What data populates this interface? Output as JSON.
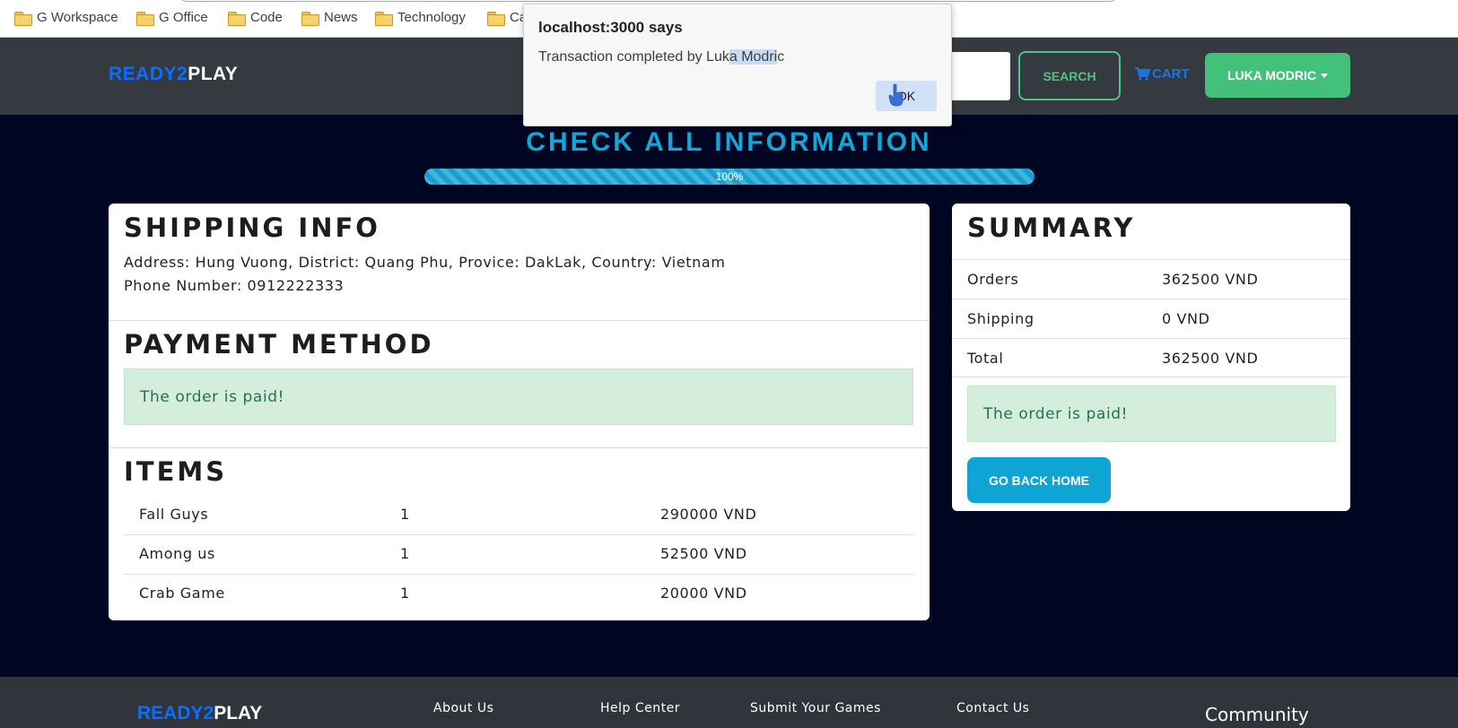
{
  "bookmarks": [
    {
      "label": "G Workspace"
    },
    {
      "label": "G Office"
    },
    {
      "label": "Code"
    },
    {
      "label": "News"
    },
    {
      "label": "Technology"
    },
    {
      "label": "Ca"
    }
  ],
  "header": {
    "brand_part1": "READY2",
    "brand_part2": "PLAY",
    "search_button": "SEARCH",
    "cart_label": "CART",
    "user_menu": "LUKA MODRIC"
  },
  "dialog": {
    "title": "localhost:3000 says",
    "message_prefix": "Transaction completed by Luk",
    "message_highlight": "a Modri",
    "message_suffix": "c",
    "ok_button": "OK"
  },
  "page": {
    "title": "CHECK ALL INFORMATION",
    "progress_label": "100%",
    "progress_value": 100
  },
  "shipping": {
    "heading": "SHIPPING INFO",
    "address": "Address: Hung Vuong, District: Quang Phu, Provice: DakLak, Country: Vietnam",
    "phone": "Phone Number: 0912222333"
  },
  "payment": {
    "heading": "PAYMENT METHOD",
    "status": "The order is paid!"
  },
  "items": {
    "heading": "ITEMS",
    "rows": [
      {
        "name": "Fall Guys",
        "qty": "1",
        "price": "290000 VND"
      },
      {
        "name": "Among us",
        "qty": "1",
        "price": "52500 VND"
      },
      {
        "name": "Crab Game",
        "qty": "1",
        "price": "20000 VND"
      }
    ]
  },
  "summary": {
    "heading": "SUMMARY",
    "rows": [
      {
        "label": "Orders",
        "value": "362500 VND"
      },
      {
        "label": "Shipping",
        "value": "0 VND"
      },
      {
        "label": "Total",
        "value": "362500 VND"
      }
    ],
    "status": "The order is paid!",
    "back_button": "GO BACK HOME"
  },
  "footer": {
    "brand_part1": "READY2",
    "brand_part2": "PLAY",
    "links": [
      {
        "label": "About Us"
      },
      {
        "label": "Help Center"
      },
      {
        "label": "Submit Your Games"
      },
      {
        "label": "Contact Us"
      }
    ],
    "community": "Community"
  },
  "colors": {
    "page_bg": "#000521",
    "header_bg": "#343a40",
    "brand_blue": "#0d6efd",
    "accent_cyan": "#12a7d4",
    "success_green": "#43c17a"
  },
  "icons": {
    "bookmark": "folder-icon",
    "cart": "shopping-cart-icon",
    "user_menu": "caret-down-icon"
  }
}
